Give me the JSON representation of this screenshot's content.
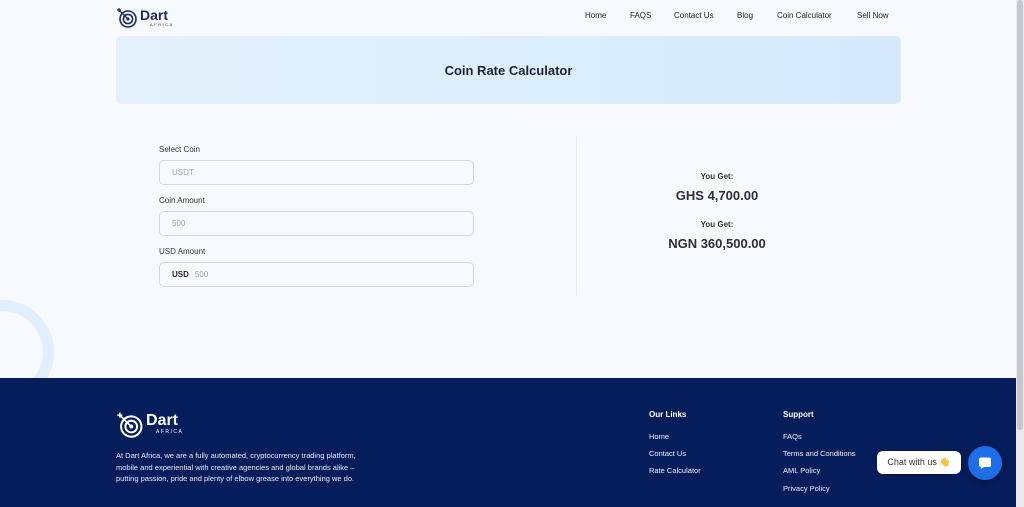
{
  "nav": {
    "logo": {
      "name": "Dart",
      "sub": "AFRICA"
    },
    "links": [
      "Home",
      "FAQS",
      "Contact Us",
      "Blog",
      "Coin Calculator",
      "Sell Now"
    ]
  },
  "hero": {
    "title": "Coin Rate Calculator"
  },
  "form": {
    "coin": {
      "label": "Select Coin",
      "value": "USDT"
    },
    "amount": {
      "label": "Coin Amount",
      "value": "500"
    },
    "usd": {
      "label": "USD Amount",
      "prefix": "USD",
      "value": "500"
    }
  },
  "results": [
    {
      "label": "You Get:",
      "value": "GHS 4,700.00"
    },
    {
      "label": "You Get:",
      "value": "NGN 360,500.00"
    }
  ],
  "footer": {
    "logo": {
      "name": "Dart",
      "sub": "AFRICA"
    },
    "about": "At Dart Africa, we are a fully automated, cryptocurrency trading platform, mobile and experiential with creative agencies and global brands alike – putting passion, pride and plenty of elbow grease into everything we do.",
    "links_title": "Our Links",
    "links": [
      "Home",
      "Contact Us",
      "Rate Calculator"
    ],
    "support_title": "Support",
    "support": [
      "FAQs",
      "Terms and Conditions",
      "AML Policy",
      "Privacy Policy"
    ]
  },
  "chat": {
    "label": "Chat with us 👋"
  },
  "colors": {
    "primary": "#051d5b",
    "accent": "#1e6ee8",
    "hero_bg": "#dbeefd"
  }
}
